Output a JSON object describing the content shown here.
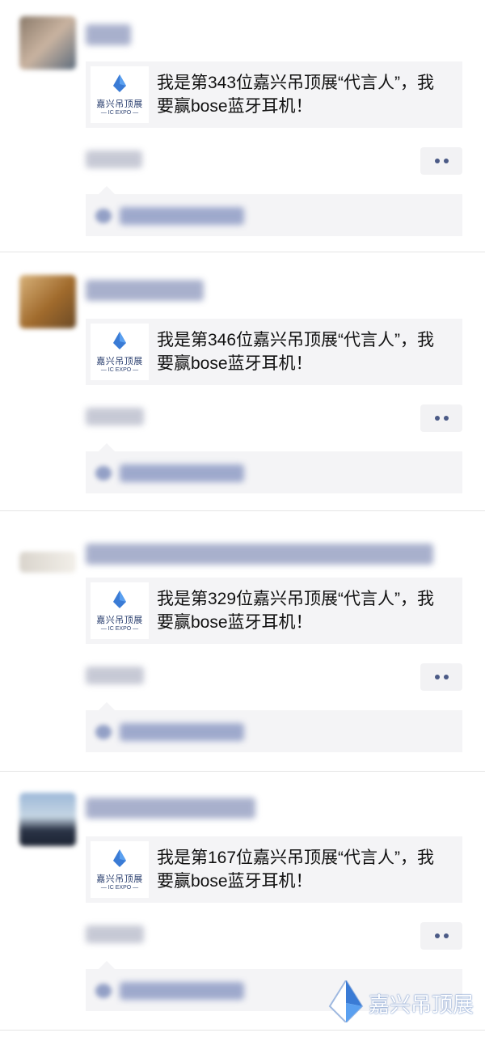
{
  "posts": [
    {
      "card_title": "我是第343位嘉兴吊顶展“代言人”，我要赢bose蓝牙耳机！",
      "time": "1小时前"
    },
    {
      "card_title": "我是第346位嘉兴吊顶展“代言人”，我要赢bose蓝牙耳机！",
      "time": "5小时前"
    },
    {
      "card_title": "我是第329位嘉兴吊顶展“代言人”，我要赢bose蓝牙耳机！",
      "time": "4小时前"
    },
    {
      "card_title": "我是第167位嘉兴吊顶展“代言人”，我要赢bose蓝牙耳机！",
      "time": "5小时前"
    }
  ],
  "thumbnail": {
    "logo_text": "嘉兴吊顶展",
    "logo_sub": "— IC EXPO —"
  },
  "watermark": {
    "text": "嘉兴吊顶展"
  },
  "colors": {
    "name_blue": "#576b95",
    "card_bg": "#f4f4f6",
    "divider": "#e5e5e5"
  },
  "icons": {
    "more": "more-dots-icon",
    "like": "heart-icon",
    "logo": "crystal-logo-icon"
  }
}
